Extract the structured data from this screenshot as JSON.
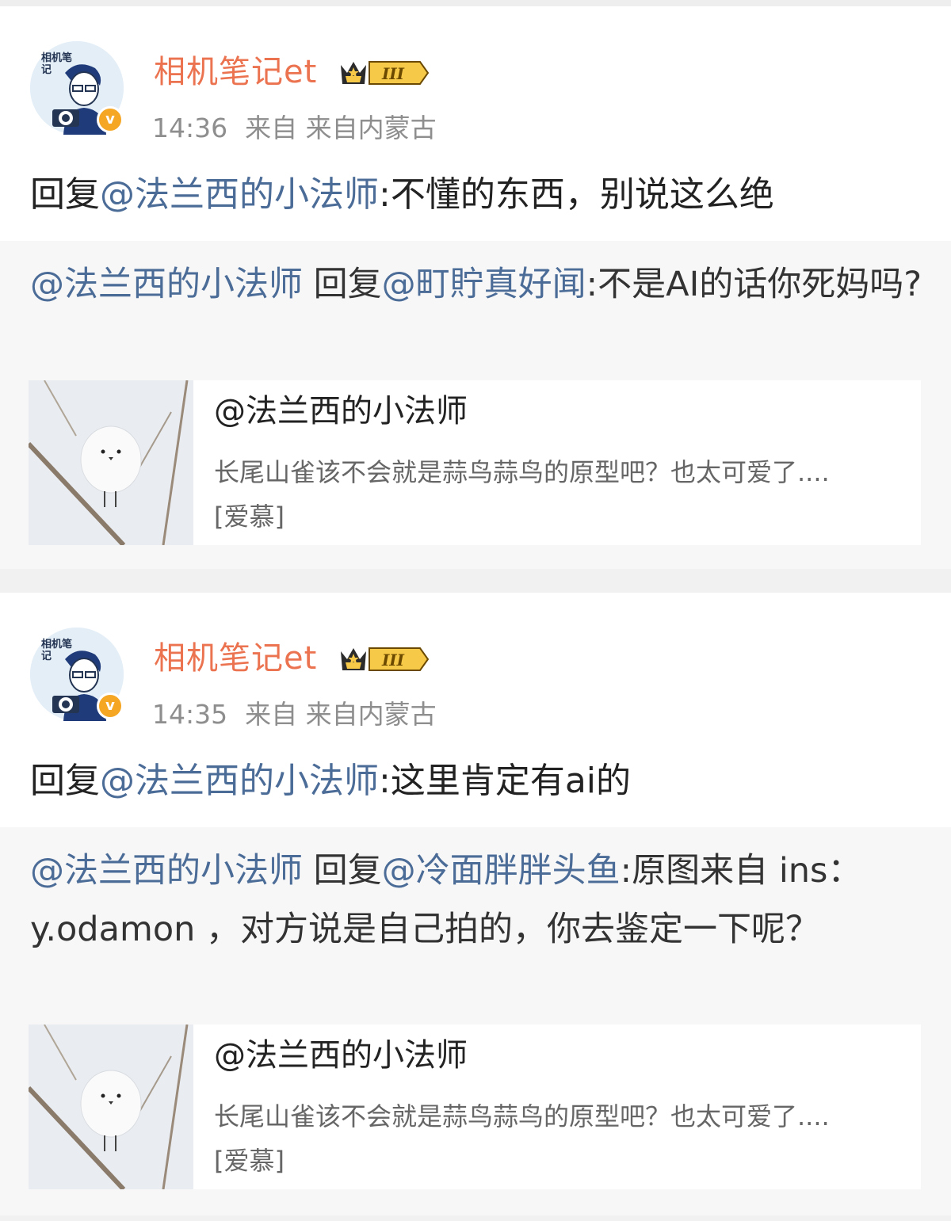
{
  "colors": {
    "username": "#eb7350",
    "mention": "#4c6c98",
    "meta": "#8e8e8e",
    "badge": "#f5a623"
  },
  "posts": [
    {
      "avatar_text": "相机笔记",
      "username": "相机笔记et",
      "badge_level": "III",
      "time": "14:36",
      "source": "来自 来自内蒙古",
      "reply_prefix": "回复",
      "reply_mention": "@法兰西的小法师",
      "reply_text": ":不懂的东西，别说这么绝",
      "quote": {
        "author_mention": "@法兰西的小法师",
        "reply_word": " 回复",
        "target_mention": "@町貯真好闻",
        "text": ":不是AI的话你死妈吗?"
      },
      "link_card": {
        "image": "bird-photo",
        "title": "@法兰西的小法师",
        "body": "长尾山雀该不会就是蒜鸟蒜鸟的原型吧？也太可爱了....",
        "emoji": "[爱慕]"
      }
    },
    {
      "avatar_text": "相机笔记",
      "username": "相机笔记et",
      "badge_level": "III",
      "time": "14:35",
      "source": "来自 来自内蒙古",
      "reply_prefix": "回复",
      "reply_mention": "@法兰西的小法师",
      "reply_text": ":这里肯定有ai的",
      "quote": {
        "author_mention": "@法兰西的小法师",
        "reply_word": " 回复",
        "target_mention": "@冷面胖胖头鱼",
        "text": ":原图来自 ins：y.odamon ，对方说是自己拍的，你去鉴定一下呢？"
      },
      "link_card": {
        "image": "bird-photo",
        "title": "@法兰西的小法师",
        "body": "长尾山雀该不会就是蒜鸟蒜鸟的原型吧？也太可爱了....",
        "emoji": "[爱慕]"
      }
    }
  ]
}
